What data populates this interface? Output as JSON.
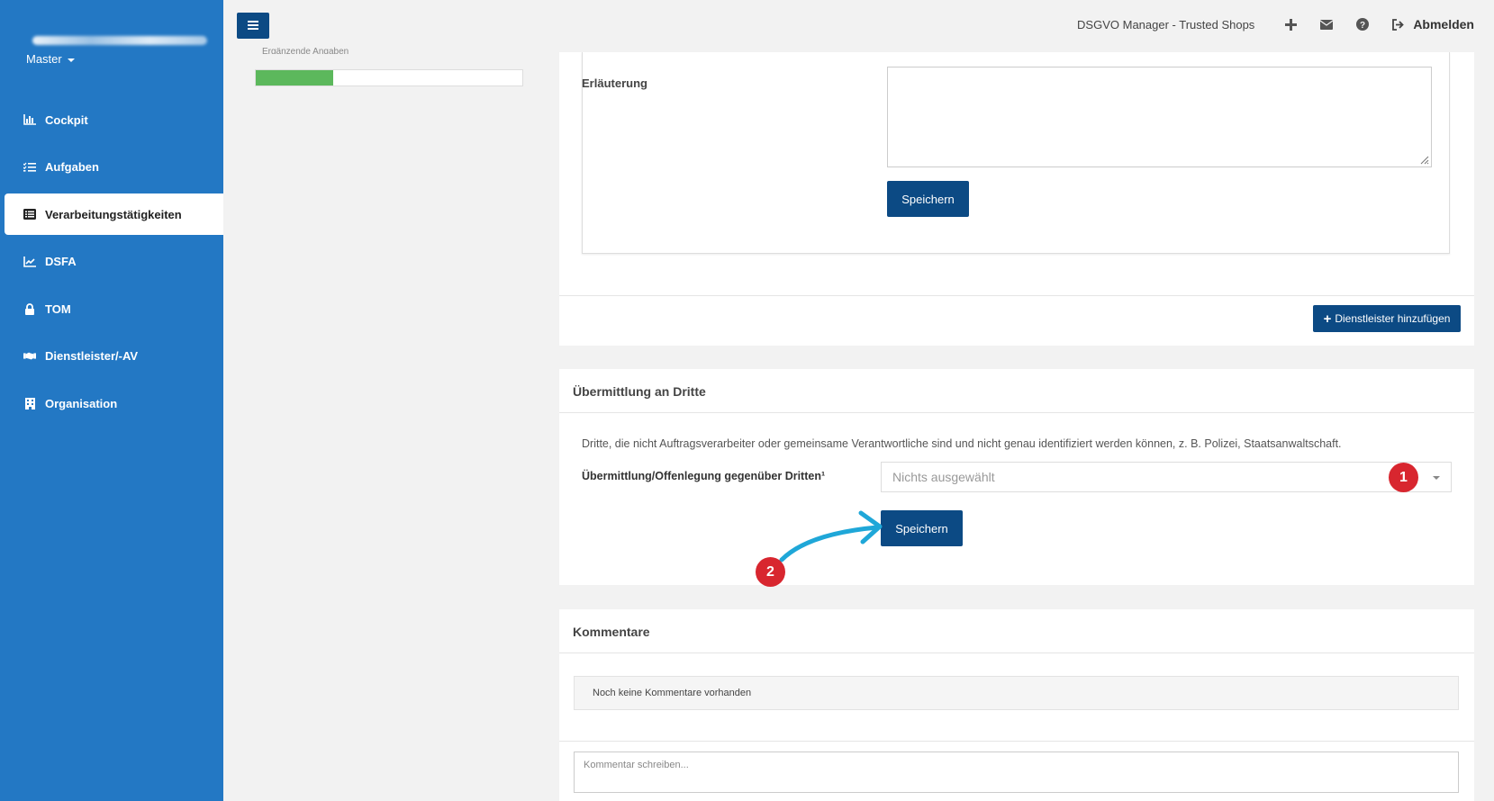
{
  "sidebar": {
    "account_label": "",
    "master_label": "Master",
    "items": [
      {
        "label": "Cockpit",
        "icon": "chart-bar-icon"
      },
      {
        "label": "Aufgaben",
        "icon": "list-check-icon"
      },
      {
        "label": "Verarbeitungstätigkeiten",
        "icon": "table-list-icon"
      },
      {
        "label": "DSFA",
        "icon": "chart-line-icon"
      },
      {
        "label": "TOM",
        "icon": "lock-icon"
      },
      {
        "label": "Dienstleister/-AV",
        "icon": "handshake-icon"
      },
      {
        "label": "Organisation",
        "icon": "building-icon"
      }
    ]
  },
  "topbar": {
    "brand": "DSGVO Manager - Trusted Shops",
    "logout_label": "Abmelden"
  },
  "progress": {
    "label": "Ergänzende Angaben",
    "value": 0.29,
    "color": "#5cb85c"
  },
  "section1": {
    "erlaeuterung_label": "Erläuterung",
    "erlaeuterung_value": "",
    "save_label": "Speichern",
    "add_provider_label": "Dienstleister hinzufügen"
  },
  "section2": {
    "title": "Übermittlung an Dritte",
    "description": "Dritte, die nicht Auftragsverarbeiter oder gemeinsame Verantwortliche sind und nicht genau identifiziert werden können, z. B. Polizei, Staatsanwaltschaft.",
    "field_label": "Übermittlung/Offenlegung gegenüber Dritten¹",
    "select_value": "Nichts ausgewählt",
    "save_label": "Speichern",
    "badge1": "1",
    "badge2": "2"
  },
  "section3": {
    "title": "Kommentare",
    "empty_text": "Noch keine Kommentare vorhanden",
    "input_placeholder": "Kommentar schreiben..."
  },
  "colors": {
    "sidebar": "#2378c4",
    "primary": "#0c4a84",
    "badge": "#d8262f",
    "arrow": "#1fa7d8"
  }
}
